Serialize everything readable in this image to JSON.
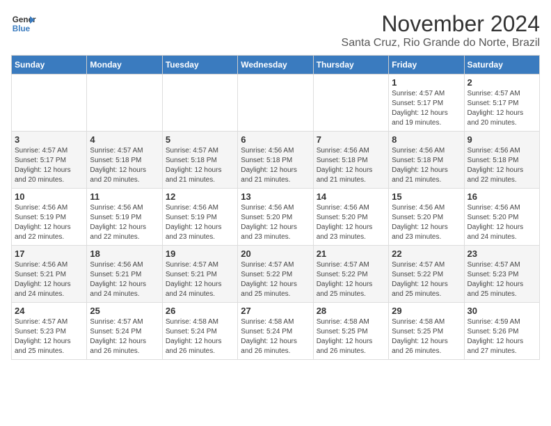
{
  "header": {
    "logo_line1": "General",
    "logo_line2": "Blue",
    "month": "November 2024",
    "location": "Santa Cruz, Rio Grande do Norte, Brazil"
  },
  "weekdays": [
    "Sunday",
    "Monday",
    "Tuesday",
    "Wednesday",
    "Thursday",
    "Friday",
    "Saturday"
  ],
  "weeks": [
    [
      {
        "day": "",
        "info": ""
      },
      {
        "day": "",
        "info": ""
      },
      {
        "day": "",
        "info": ""
      },
      {
        "day": "",
        "info": ""
      },
      {
        "day": "",
        "info": ""
      },
      {
        "day": "1",
        "info": "Sunrise: 4:57 AM\nSunset: 5:17 PM\nDaylight: 12 hours and 19 minutes."
      },
      {
        "day": "2",
        "info": "Sunrise: 4:57 AM\nSunset: 5:17 PM\nDaylight: 12 hours and 20 minutes."
      }
    ],
    [
      {
        "day": "3",
        "info": "Sunrise: 4:57 AM\nSunset: 5:17 PM\nDaylight: 12 hours and 20 minutes."
      },
      {
        "day": "4",
        "info": "Sunrise: 4:57 AM\nSunset: 5:18 PM\nDaylight: 12 hours and 20 minutes."
      },
      {
        "day": "5",
        "info": "Sunrise: 4:57 AM\nSunset: 5:18 PM\nDaylight: 12 hours and 21 minutes."
      },
      {
        "day": "6",
        "info": "Sunrise: 4:56 AM\nSunset: 5:18 PM\nDaylight: 12 hours and 21 minutes."
      },
      {
        "day": "7",
        "info": "Sunrise: 4:56 AM\nSunset: 5:18 PM\nDaylight: 12 hours and 21 minutes."
      },
      {
        "day": "8",
        "info": "Sunrise: 4:56 AM\nSunset: 5:18 PM\nDaylight: 12 hours and 21 minutes."
      },
      {
        "day": "9",
        "info": "Sunrise: 4:56 AM\nSunset: 5:18 PM\nDaylight: 12 hours and 22 minutes."
      }
    ],
    [
      {
        "day": "10",
        "info": "Sunrise: 4:56 AM\nSunset: 5:19 PM\nDaylight: 12 hours and 22 minutes."
      },
      {
        "day": "11",
        "info": "Sunrise: 4:56 AM\nSunset: 5:19 PM\nDaylight: 12 hours and 22 minutes."
      },
      {
        "day": "12",
        "info": "Sunrise: 4:56 AM\nSunset: 5:19 PM\nDaylight: 12 hours and 23 minutes."
      },
      {
        "day": "13",
        "info": "Sunrise: 4:56 AM\nSunset: 5:20 PM\nDaylight: 12 hours and 23 minutes."
      },
      {
        "day": "14",
        "info": "Sunrise: 4:56 AM\nSunset: 5:20 PM\nDaylight: 12 hours and 23 minutes."
      },
      {
        "day": "15",
        "info": "Sunrise: 4:56 AM\nSunset: 5:20 PM\nDaylight: 12 hours and 23 minutes."
      },
      {
        "day": "16",
        "info": "Sunrise: 4:56 AM\nSunset: 5:20 PM\nDaylight: 12 hours and 24 minutes."
      }
    ],
    [
      {
        "day": "17",
        "info": "Sunrise: 4:56 AM\nSunset: 5:21 PM\nDaylight: 12 hours and 24 minutes."
      },
      {
        "day": "18",
        "info": "Sunrise: 4:56 AM\nSunset: 5:21 PM\nDaylight: 12 hours and 24 minutes."
      },
      {
        "day": "19",
        "info": "Sunrise: 4:57 AM\nSunset: 5:21 PM\nDaylight: 12 hours and 24 minutes."
      },
      {
        "day": "20",
        "info": "Sunrise: 4:57 AM\nSunset: 5:22 PM\nDaylight: 12 hours and 25 minutes."
      },
      {
        "day": "21",
        "info": "Sunrise: 4:57 AM\nSunset: 5:22 PM\nDaylight: 12 hours and 25 minutes."
      },
      {
        "day": "22",
        "info": "Sunrise: 4:57 AM\nSunset: 5:22 PM\nDaylight: 12 hours and 25 minutes."
      },
      {
        "day": "23",
        "info": "Sunrise: 4:57 AM\nSunset: 5:23 PM\nDaylight: 12 hours and 25 minutes."
      }
    ],
    [
      {
        "day": "24",
        "info": "Sunrise: 4:57 AM\nSunset: 5:23 PM\nDaylight: 12 hours and 25 minutes."
      },
      {
        "day": "25",
        "info": "Sunrise: 4:57 AM\nSunset: 5:24 PM\nDaylight: 12 hours and 26 minutes."
      },
      {
        "day": "26",
        "info": "Sunrise: 4:58 AM\nSunset: 5:24 PM\nDaylight: 12 hours and 26 minutes."
      },
      {
        "day": "27",
        "info": "Sunrise: 4:58 AM\nSunset: 5:24 PM\nDaylight: 12 hours and 26 minutes."
      },
      {
        "day": "28",
        "info": "Sunrise: 4:58 AM\nSunset: 5:25 PM\nDaylight: 12 hours and 26 minutes."
      },
      {
        "day": "29",
        "info": "Sunrise: 4:58 AM\nSunset: 5:25 PM\nDaylight: 12 hours and 26 minutes."
      },
      {
        "day": "30",
        "info": "Sunrise: 4:59 AM\nSunset: 5:26 PM\nDaylight: 12 hours and 27 minutes."
      }
    ]
  ]
}
